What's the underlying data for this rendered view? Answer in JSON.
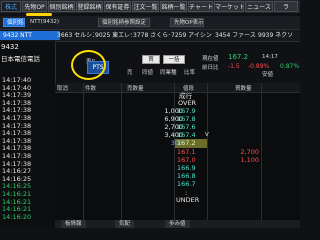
{
  "top_tabs": [
    {
      "label": "株式",
      "active": true
    },
    {
      "label": "先物OP",
      "active": false
    },
    {
      "label": "個別銘柄",
      "active": false
    },
    {
      "label": "登録銘柄",
      "active": false
    },
    {
      "label": "保有証券",
      "active": false
    },
    {
      "label": "注文一覧",
      "active": false
    },
    {
      "label": "銘柄一覧",
      "active": false
    },
    {
      "label": "チャート",
      "active": false
    },
    {
      "label": "マーケット",
      "active": false
    },
    {
      "label": "ニュース",
      "active": false
    },
    {
      "label": "ラ",
      "active": false
    }
  ],
  "toolbar2": {
    "title_badge": "個別銘柄",
    "title_text": "NTT(9432)",
    "btn_ref": "個別銘柄参照設定",
    "btn_futures": "先物OP表示"
  },
  "ticker": {
    "items": [
      "9432 NTT",
      "3663 セルシス",
      "9025 東エレク",
      "3778 さくらイ",
      "7259 アイシン",
      "3454 ファース",
      "9939 ネクソ"
    ],
    "left_code": "9432"
  },
  "stock": {
    "code": "9432",
    "name": "日本電信電話"
  },
  "controls": {
    "label_market": "東P",
    "pts_label": "PTS",
    "buy_label": "買板",
    "batch_label": "一括売",
    "sell_label": "売",
    "pool_label": "同値",
    "group_label": "同業種",
    "hiyoke_label": "比率"
  },
  "price_block": {
    "current_label": "現在値",
    "current_value": "167.2",
    "time": "14:17",
    "change_label": "前日比",
    "change_value": "-1.5",
    "change_pct": "-0.89%",
    "small_label": "0.87%",
    "high_label": "安値"
  },
  "board_headers": {
    "cancel": "取消",
    "qty": "件数",
    "sell_qty": "売数量",
    "price": "値段",
    "buy_qty": "買数量",
    "market": "成行"
  },
  "board": {
    "over_label": "OVER",
    "under_label": "UNDER",
    "sell_rows": [
      {
        "qty": "1,000",
        "price": "167.9"
      },
      {
        "qty": "6,900",
        "price": "167.8"
      },
      {
        "qty": "2,700",
        "price": "167.6"
      },
      {
        "qty": "3,400",
        "price": "167.4"
      },
      {
        "qty": "300",
        "price": "167.2",
        "highlight": true
      }
    ],
    "buy_rows": [
      {
        "qty": "2,700",
        "price": "167.1"
      },
      {
        "qty": "1,100",
        "price": "167.0"
      },
      {
        "qty": "",
        "price": "166.9"
      },
      {
        "qty": "",
        "price": "166.8"
      },
      {
        "qty": "",
        "price": "166.7"
      }
    ],
    "arrow_marks": [
      "V"
    ]
  },
  "left_times": [
    {
      "t": "14:17:40",
      "green": false
    },
    {
      "t": "14:17:40",
      "green": false
    },
    {
      "t": "14:17:39",
      "green": false
    },
    {
      "t": "14:17:38",
      "green": false
    },
    {
      "t": "14:17:38",
      "green": false
    },
    {
      "t": "14:17:38",
      "green": false
    },
    {
      "t": "14:17:38",
      "green": false
    },
    {
      "t": "14:17:38",
      "green": false
    },
    {
      "t": "14:17:38",
      "green": false
    },
    {
      "t": "14:17:38",
      "green": false
    },
    {
      "t": "14:17:38",
      "green": false
    },
    {
      "t": "14:17:38",
      "green": false
    },
    {
      "t": "14:16:27",
      "green": false
    },
    {
      "t": "14:16:25",
      "green": false
    },
    {
      "t": "14:16:25",
      "green": true
    },
    {
      "t": "14:16:21",
      "green": true
    },
    {
      "t": "14:16:21",
      "green": true
    },
    {
      "t": "14:16:21",
      "green": true
    },
    {
      "t": "14:16:20",
      "green": true
    }
  ],
  "bottom_tabs": [
    "板情報",
    "気配",
    "歩み値"
  ]
}
